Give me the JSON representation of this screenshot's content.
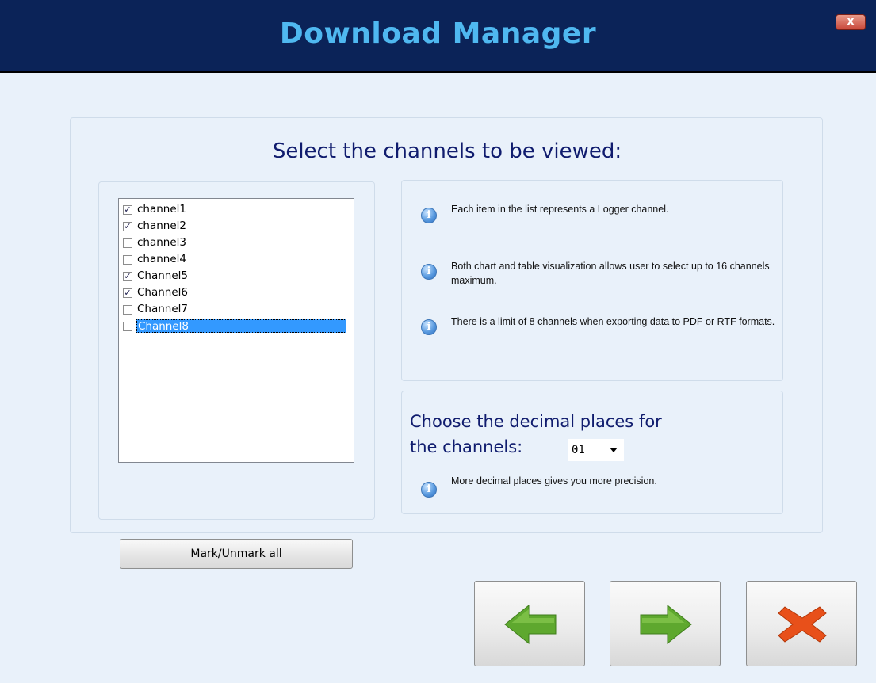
{
  "window": {
    "title": "Download Manager",
    "close_label": "x"
  },
  "main": {
    "heading": "Select the channels to be viewed:",
    "channels": [
      {
        "label": "channel1",
        "checked": true,
        "check": "✓"
      },
      {
        "label": "channel2",
        "checked": true,
        "check": "✓"
      },
      {
        "label": "channel3",
        "checked": false,
        "check": ""
      },
      {
        "label": "channel4",
        "checked": false,
        "check": ""
      },
      {
        "label": "Channel5",
        "checked": true,
        "check": "✓"
      },
      {
        "label": "Channel6",
        "checked": true,
        "check": "✓"
      },
      {
        "label": "Channel7",
        "checked": false,
        "check": ""
      },
      {
        "label": "Channel8",
        "checked": false,
        "check": "",
        "selected": true
      }
    ],
    "mark_all_label": "Mark/Unmark all"
  },
  "info": {
    "icon": "info-icon",
    "icon_glyph": "i",
    "items": [
      "Each item in the list represents a Logger channel.",
      "Both chart and table visualization allows user to select up to 16 channels maximum.",
      "There is a limit of 8 channels when exporting data to PDF or RTF formats."
    ]
  },
  "decimal": {
    "title_line1": "Choose the decimal places for",
    "title_line2": "the channels:",
    "selected_value": "01",
    "hint": "More decimal places gives you more precision."
  },
  "nav": {
    "back_icon": "arrow-left-icon",
    "next_icon": "arrow-right-icon",
    "cancel_icon": "cancel-x-icon"
  },
  "colors": {
    "title_bar": "#0b2358",
    "title_text": "#4fb8f0",
    "heading_text": "#101c6e",
    "selection": "#3399ff",
    "arrow_green": "#5ea82e",
    "cancel_orange": "#e8501a"
  }
}
